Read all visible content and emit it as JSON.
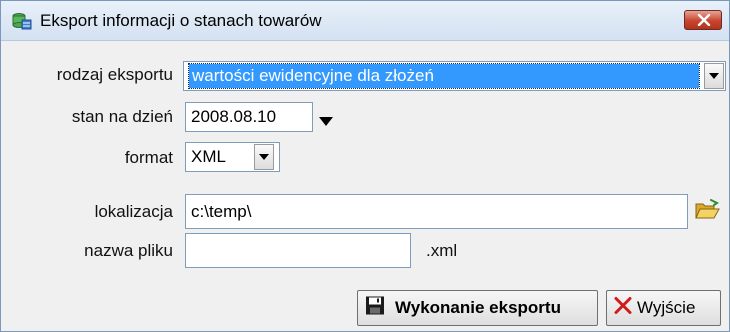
{
  "window": {
    "title": "Eksport informacji o stanach towarów",
    "close_label": "X"
  },
  "form": {
    "export_type": {
      "label": "rodzaj eksportu",
      "value": "wartości ewidencyjne dla złożeń"
    },
    "date": {
      "label": "stan na dzień",
      "value": "2008.08.10"
    },
    "format": {
      "label": "format",
      "value": "XML"
    },
    "location": {
      "label": "lokalizacja",
      "value": "c:\\temp\\"
    },
    "filename": {
      "label": "nazwa pliku",
      "value": "",
      "extension": ".xml"
    }
  },
  "buttons": {
    "export": "Wykonanie eksportu",
    "exit": "Wyjście"
  },
  "colors": {
    "selection": "#3399ff",
    "exit_icon": "#d11a1a",
    "folder_icon": "#e8c23c"
  },
  "icons": {
    "app": "database-app-icon",
    "folder": "folder-open-icon",
    "save": "floppy-disk-icon",
    "exit": "x-mark-icon"
  }
}
